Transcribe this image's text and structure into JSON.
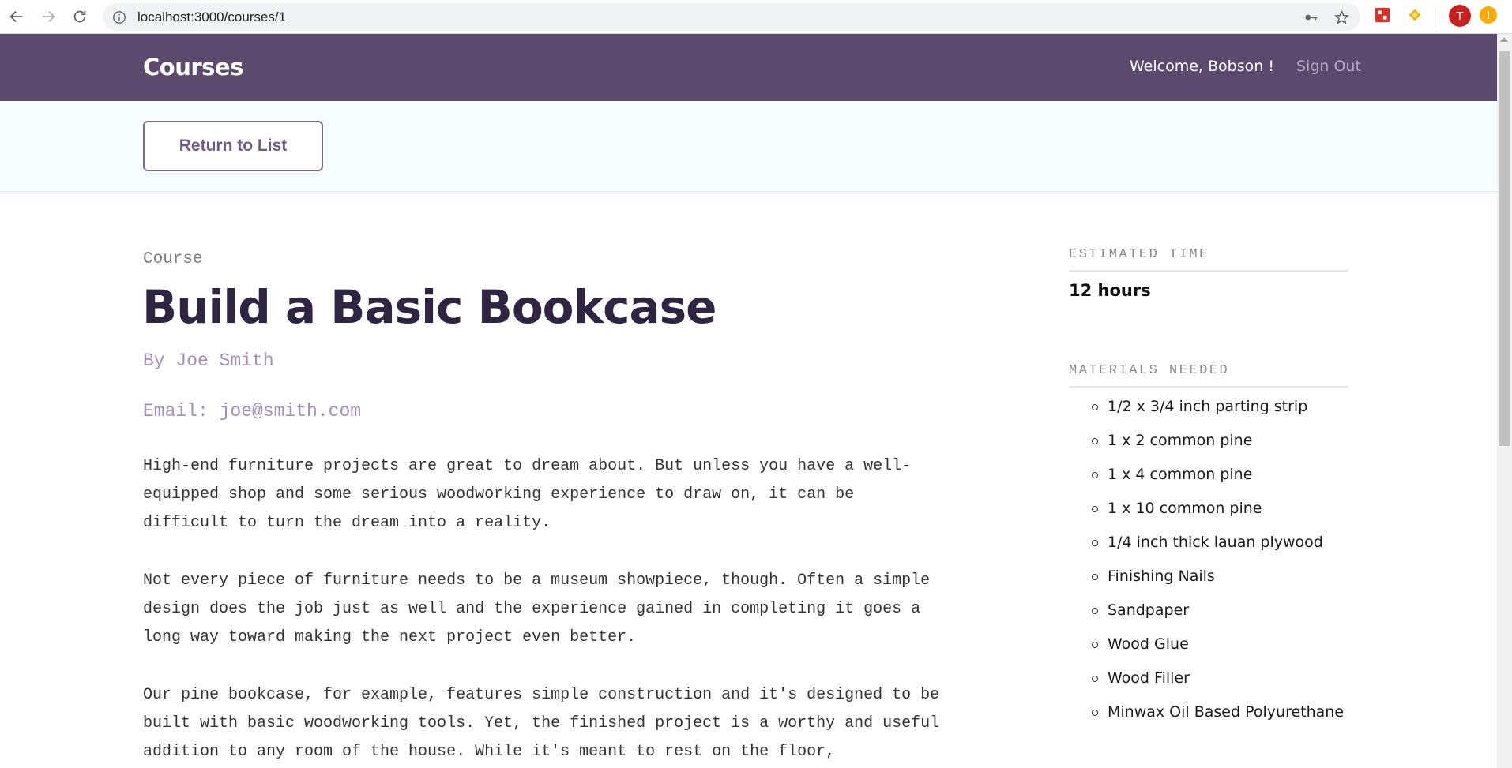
{
  "browser": {
    "url": "localhost:3000/courses/1",
    "profile_initial": "T",
    "alert_symbol": "!"
  },
  "header": {
    "brand": "Courses",
    "welcome": "Welcome, Bobson !",
    "sign_out": "Sign Out",
    "bg_color": "#5b4a6e"
  },
  "actions": {
    "return_label": "Return to List"
  },
  "course": {
    "label": "Course",
    "title": "Build a Basic Bookcase",
    "byline": "By Joe Smith",
    "email": "Email: joe@smith.com",
    "description": [
      "High-end furniture projects are great to dream about. But unless you have a well-equipped shop and some serious woodworking experience to draw on, it can be difficult to turn the dream into a reality.",
      "Not every piece of furniture needs to be a museum showpiece, though. Often a simple design does the job just as well and the experience gained in completing it goes a long way toward making the next project even better.",
      "Our pine bookcase, for example, features simple construction and it's designed to be built with basic woodworking tools. Yet, the finished project is a worthy and useful addition to any room of the house. While it's meant to rest on the floor,"
    ]
  },
  "sidebar": {
    "estimated_time_heading": "ESTIMATED TIME",
    "estimated_time": "12 hours",
    "materials_heading": "MATERIALS NEEDED",
    "materials": [
      "1/2 x 3/4 inch parting strip",
      "1 x 2 common pine",
      "1 x 4 common pine",
      "1 x 10 common pine",
      "1/4 inch thick lauan plywood",
      "Finishing Nails",
      "Sandpaper",
      "Wood Glue",
      "Wood Filler",
      "Minwax Oil Based Polyurethane"
    ]
  }
}
